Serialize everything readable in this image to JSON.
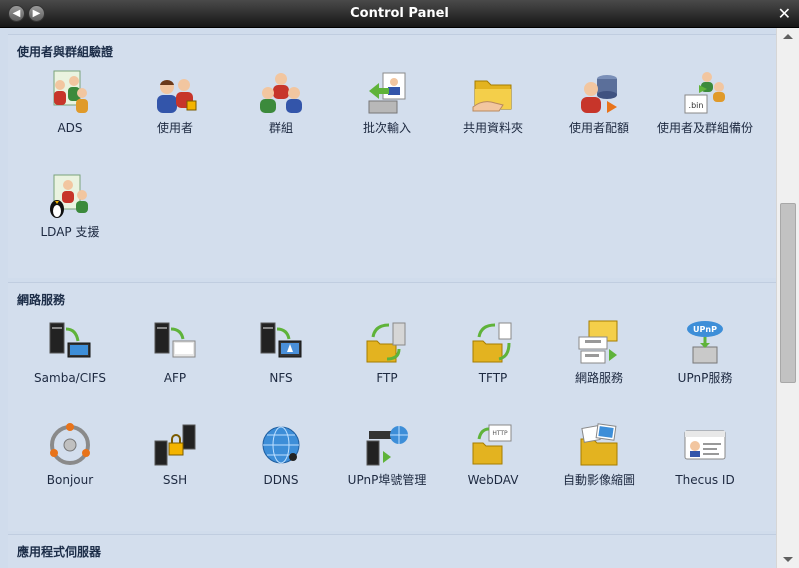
{
  "window": {
    "title": "Control Panel"
  },
  "sections": [
    {
      "title": "使用者與群組驗證",
      "items": [
        {
          "label": "ADS",
          "icon": "ads-users-icon"
        },
        {
          "label": "使用者",
          "icon": "user-icon"
        },
        {
          "label": "群組",
          "icon": "group-icon"
        },
        {
          "label": "批次輸入",
          "icon": "batch-import-icon"
        },
        {
          "label": "共用資料夾",
          "icon": "shared-folder-icon"
        },
        {
          "label": "使用者配額",
          "icon": "user-quota-icon"
        },
        {
          "label": "使用者及群組備份",
          "icon": "backup-bin-icon"
        },
        {
          "label": "LDAP 支援",
          "icon": "ldap-penguin-icon"
        }
      ]
    },
    {
      "title": "網路服務",
      "items": [
        {
          "label": "Samba/CIFS",
          "icon": "samba-icon"
        },
        {
          "label": "AFP",
          "icon": "afp-icon"
        },
        {
          "label": "NFS",
          "icon": "nfs-icon"
        },
        {
          "label": "FTP",
          "icon": "ftp-icon"
        },
        {
          "label": "TFTP",
          "icon": "tftp-icon"
        },
        {
          "label": "網路服務",
          "icon": "web-service-icon"
        },
        {
          "label": "UPnP服務",
          "icon": "upnp-icon"
        },
        {
          "label": "Bonjour",
          "icon": "bonjour-icon"
        },
        {
          "label": "SSH",
          "icon": "ssh-lock-icon"
        },
        {
          "label": "DDNS",
          "icon": "ddns-globe-icon"
        },
        {
          "label": "UPnP埠號管理",
          "icon": "upnp-port-icon"
        },
        {
          "label": "WebDAV",
          "icon": "webdav-icon"
        },
        {
          "label": "自動影像縮圖",
          "icon": "thumbnail-icon"
        },
        {
          "label": "Thecus ID",
          "icon": "thecus-id-icon"
        }
      ]
    },
    {
      "title": "應用程式伺服器",
      "items": []
    }
  ]
}
